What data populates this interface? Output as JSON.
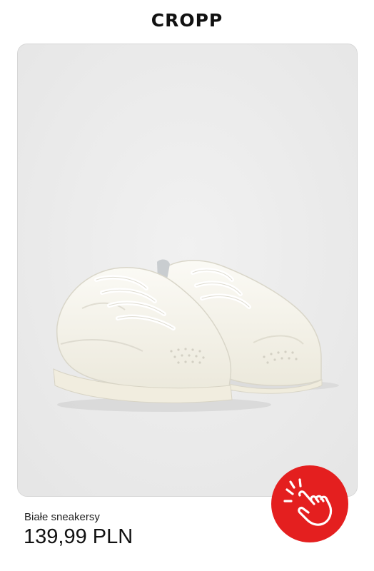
{
  "brand": {
    "logo_text": "CROPP"
  },
  "product": {
    "name": "Białe sneakersy",
    "price": "139,99 PLN",
    "image_icon": "white-sneakers-photo"
  },
  "cta": {
    "icon": "tap-hand-icon",
    "color": "#e41f1f"
  },
  "colors": {
    "card_bg": "#ececec",
    "accent": "#e41f1f",
    "text": "#111111"
  }
}
